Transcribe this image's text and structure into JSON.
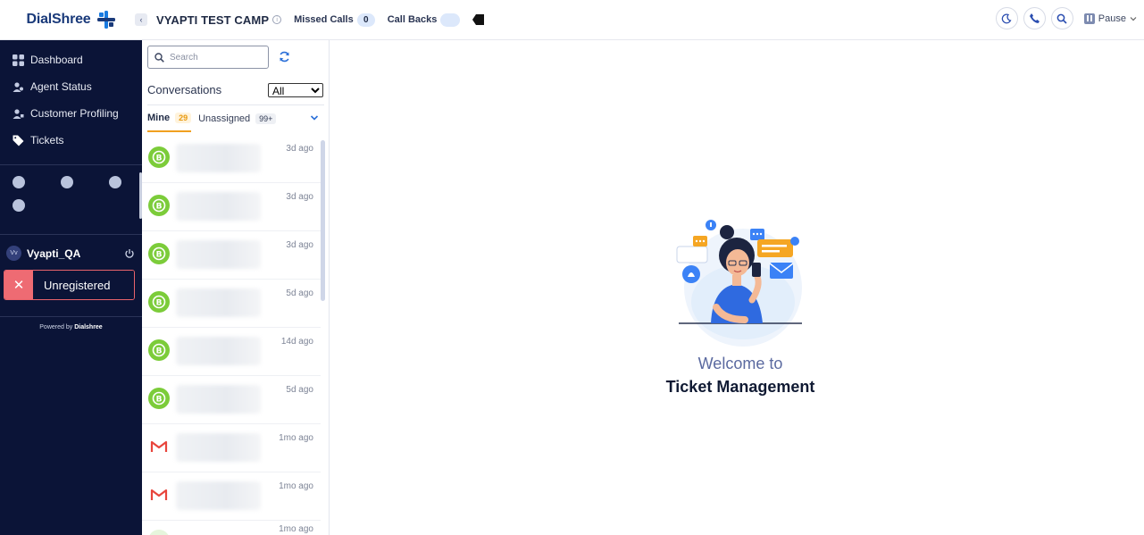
{
  "brand": {
    "name": "DialShree"
  },
  "header": {
    "campaign": "VYAPTI TEST CAMP",
    "missed_calls_label": "Missed Calls",
    "missed_calls_count": "0",
    "call_backs_label": "Call Backs",
    "call_backs_count": "",
    "pause_label": "Pause"
  },
  "sidebar": {
    "items": [
      {
        "label": "Dashboard",
        "icon": "grid-icon"
      },
      {
        "label": "Agent Status",
        "icon": "users-icon"
      },
      {
        "label": "Customer Profiling",
        "icon": "profile-icon"
      },
      {
        "label": "Tickets",
        "icon": "ticket-icon"
      }
    ],
    "user": {
      "initials": "Vv",
      "name": "Vyapti_QA"
    },
    "status": "Unregistered",
    "powered_prefix": "Powered by ",
    "powered_brand": "Dialshree"
  },
  "conversations": {
    "search_placeholder": "Search",
    "title": "Conversations",
    "filter_selected": "All",
    "tabs": [
      {
        "label": "Mine",
        "count": "29"
      },
      {
        "label": "Unassigned",
        "count": "99+"
      }
    ],
    "rows": [
      {
        "channel": "whatsapp",
        "ago": "3d ago"
      },
      {
        "channel": "whatsapp",
        "ago": "3d ago"
      },
      {
        "channel": "whatsapp",
        "ago": "3d ago"
      },
      {
        "channel": "whatsapp",
        "ago": "5d ago"
      },
      {
        "channel": "whatsapp",
        "ago": "14d ago"
      },
      {
        "channel": "whatsapp",
        "ago": "5d ago"
      },
      {
        "channel": "gmail",
        "ago": "1mo ago"
      },
      {
        "channel": "gmail",
        "ago": "1mo ago"
      },
      {
        "channel": "chat",
        "ago": "1mo ago"
      }
    ]
  },
  "main": {
    "welcome": "Welcome to",
    "title": "Ticket Management"
  },
  "colors": {
    "sidebar_bg": "#0b1437",
    "accent": "#f0a020",
    "whatsapp": "#7ccc3a",
    "gmail": "#e8453c",
    "unregistered": "#ee6b73"
  }
}
